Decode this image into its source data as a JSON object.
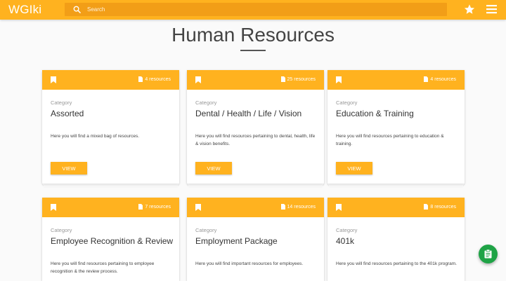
{
  "app": {
    "logo": "WGIki"
  },
  "search": {
    "placeholder": "Search"
  },
  "page": {
    "title": "Human Resources"
  },
  "cards": [
    {
      "count": "4 resources",
      "category_label": "Category",
      "name": "Assorted",
      "description": "Here you will find a mixed bag of resources.",
      "button": "VIEW"
    },
    {
      "count": "25 resources",
      "category_label": "Category",
      "name": "Dental / Health / Life / Vision",
      "description": "Here you will find resources pertaining to dental, health, life & vision benefits.",
      "button": "VIEW"
    },
    {
      "count": "4 resources",
      "category_label": "Category",
      "name": "Education & Training",
      "description": "Here you will find resources pertaining to education & training.",
      "button": "VIEW"
    },
    {
      "count": "7 resources",
      "category_label": "Category",
      "name": "Employee Recognition & Review",
      "description": "Here you will find resources pertaining to employee recognition & the review process.",
      "button": "VIEW"
    },
    {
      "count": "14 resources",
      "category_label": "Category",
      "name": "Employment Package",
      "description": "Here you will find important resources for employees.",
      "button": "VIEW"
    },
    {
      "count": "8 resources",
      "category_label": "Category",
      "name": "401k",
      "description": "Here you will find resources pertaining to the 401k program.",
      "button": "VIEW"
    }
  ],
  "icons": {
    "search": "search-icon",
    "star": "star-icon",
    "menu": "menu-icon",
    "bookmark": "bookmark-icon",
    "document": "document-icon",
    "clipboard": "clipboard-icon"
  },
  "colors": {
    "accent": "#ffb21f",
    "search_bg": "#f29e17",
    "fab": "#1fa346"
  }
}
